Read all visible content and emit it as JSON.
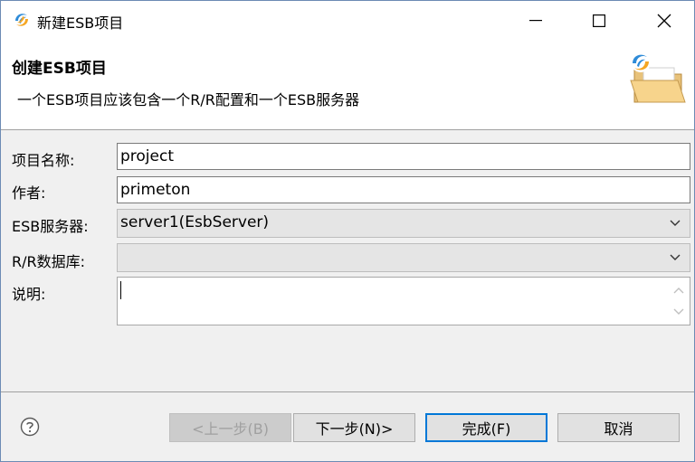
{
  "window": {
    "title": "新建ESB项目"
  },
  "header": {
    "title": "创建ESB项目",
    "description": "一个ESB项目应该包含一个R/R配置和一个ESB服务器"
  },
  "form": {
    "project_name_label": "项目名称:",
    "project_name_value": "project",
    "author_label": "作者:",
    "author_value": "primeton",
    "esb_server_label": "ESB服务器:",
    "esb_server_value": "server1(EsbServer)",
    "rr_db_label": "R/R数据库:",
    "rr_db_value": "",
    "description_label": "说明:",
    "description_value": ""
  },
  "footer": {
    "back_label": "<上一步(B)",
    "next_label": "下一步(N)>",
    "finish_label": "完成(F)",
    "cancel_label": "取消"
  },
  "colors": {
    "accent": "#0078d7",
    "window_bg": "#f0f0f0"
  },
  "icons": [
    "app-logo-icon",
    "minimize-icon",
    "maximize-icon",
    "close-icon",
    "folder-icon",
    "chevron-down-icon",
    "help-icon"
  ]
}
